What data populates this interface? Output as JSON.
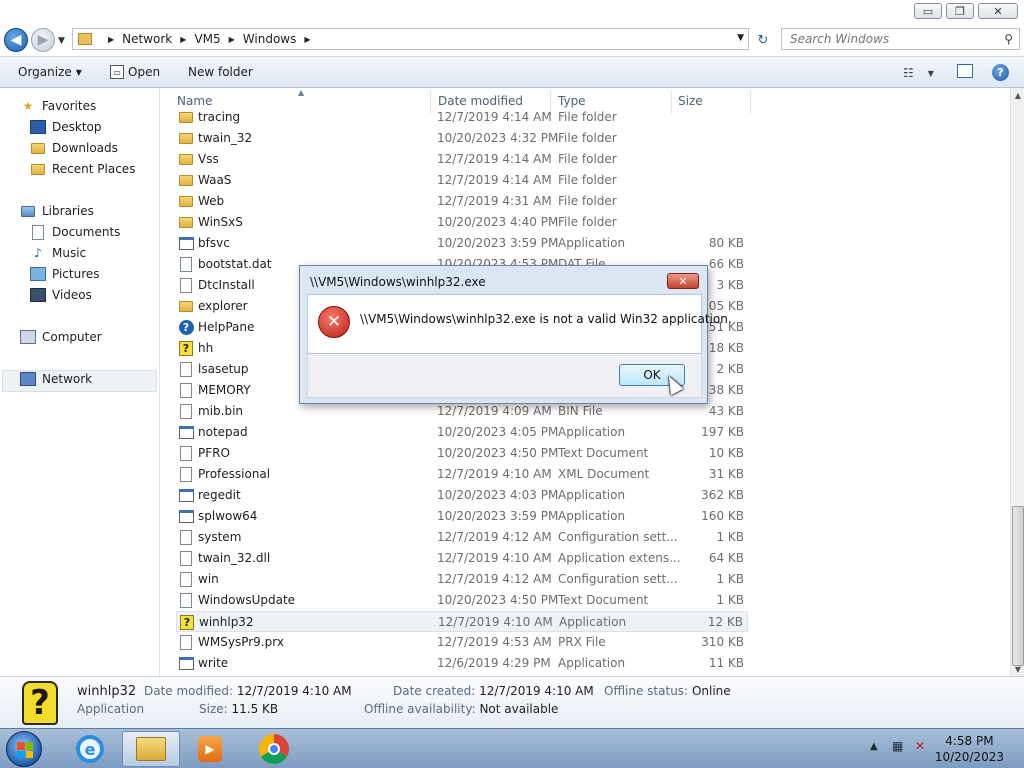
{
  "window": {
    "buttons": {
      "minimize": "▭",
      "maximize": "❐",
      "close": "✕"
    }
  },
  "address": {
    "crumbs": [
      "Network",
      "VM5",
      "Windows"
    ],
    "search_placeholder": "Search Windows"
  },
  "toolbar": {
    "organize": "Organize",
    "open": "Open",
    "new_folder": "New folder"
  },
  "navpane": {
    "favorites": "Favorites",
    "desktop": "Desktop",
    "downloads": "Downloads",
    "recent_places": "Recent Places",
    "libraries": "Libraries",
    "documents": "Documents",
    "music": "Music",
    "pictures": "Pictures",
    "videos": "Videos",
    "computer": "Computer",
    "network": "Network"
  },
  "columns": {
    "name": "Name",
    "date": "Date modified",
    "type": "Type",
    "size": "Size"
  },
  "files": [
    {
      "name": "tracing",
      "date": "12/7/2019 4:14 AM",
      "type": "File folder",
      "size": "",
      "icon": "folder"
    },
    {
      "name": "twain_32",
      "date": "10/20/2023 4:32 PM",
      "type": "File folder",
      "size": "",
      "icon": "folder"
    },
    {
      "name": "Vss",
      "date": "12/7/2019 4:14 AM",
      "type": "File folder",
      "size": "",
      "icon": "folder"
    },
    {
      "name": "WaaS",
      "date": "12/7/2019 4:14 AM",
      "type": "File folder",
      "size": "",
      "icon": "folder"
    },
    {
      "name": "Web",
      "date": "12/7/2019 4:31 AM",
      "type": "File folder",
      "size": "",
      "icon": "folder"
    },
    {
      "name": "WinSxS",
      "date": "10/20/2023 4:40 PM",
      "type": "File folder",
      "size": "",
      "icon": "folder"
    },
    {
      "name": "bfsvc",
      "date": "10/20/2023 3:59 PM",
      "type": "Application",
      "size": "80 KB",
      "icon": "app"
    },
    {
      "name": "bootstat.dat",
      "date": "10/20/2023 4:53 PM",
      "type": "DAT File",
      "size": "66 KB",
      "icon": "doc"
    },
    {
      "name": "DtcInstall",
      "date": "",
      "type": "",
      "size": "3 KB",
      "icon": "doc"
    },
    {
      "name": "explorer",
      "date": "",
      "type": "",
      "size": "205 KB",
      "icon": "folder"
    },
    {
      "name": "HelpPane",
      "date": "",
      "type": "",
      "size": "051 KB",
      "icon": "qblue"
    },
    {
      "name": "hh",
      "date": "",
      "type": "",
      "size": "18 KB",
      "icon": "help"
    },
    {
      "name": "lsasetup",
      "date": "",
      "type": "",
      "size": "2 KB",
      "icon": "doc"
    },
    {
      "name": "MEMORY",
      "date": "",
      "type": "",
      "size": "138 KB",
      "icon": "doc"
    },
    {
      "name": "mib.bin",
      "date": "12/7/2019 4:09 AM",
      "type": "BIN File",
      "size": "43 KB",
      "icon": "doc"
    },
    {
      "name": "notepad",
      "date": "10/20/2023 4:05 PM",
      "type": "Application",
      "size": "197 KB",
      "icon": "app"
    },
    {
      "name": "PFRO",
      "date": "10/20/2023 4:50 PM",
      "type": "Text Document",
      "size": "10 KB",
      "icon": "doc"
    },
    {
      "name": "Professional",
      "date": "12/7/2019 4:10 AM",
      "type": "XML Document",
      "size": "31 KB",
      "icon": "doc"
    },
    {
      "name": "regedit",
      "date": "10/20/2023 4:03 PM",
      "type": "Application",
      "size": "362 KB",
      "icon": "app"
    },
    {
      "name": "splwow64",
      "date": "10/20/2023 3:59 PM",
      "type": "Application",
      "size": "160 KB",
      "icon": "app"
    },
    {
      "name": "system",
      "date": "12/7/2019 4:12 AM",
      "type": "Configuration sett...",
      "size": "1 KB",
      "icon": "doc"
    },
    {
      "name": "twain_32.dll",
      "date": "12/7/2019 4:10 AM",
      "type": "Application extens...",
      "size": "64 KB",
      "icon": "doc"
    },
    {
      "name": "win",
      "date": "12/7/2019 4:12 AM",
      "type": "Configuration sett...",
      "size": "1 KB",
      "icon": "doc"
    },
    {
      "name": "WindowsUpdate",
      "date": "10/20/2023 4:50 PM",
      "type": "Text Document",
      "size": "1 KB",
      "icon": "doc"
    },
    {
      "name": "winhlp32",
      "date": "12/7/2019 4:10 AM",
      "type": "Application",
      "size": "12 KB",
      "icon": "help",
      "selected": true
    },
    {
      "name": "WMSysPr9.prx",
      "date": "12/7/2019 4:53 AM",
      "type": "PRX File",
      "size": "310 KB",
      "icon": "doc"
    },
    {
      "name": "write",
      "date": "12/6/2019 4:29 PM",
      "type": "Application",
      "size": "11 KB",
      "icon": "app"
    }
  ],
  "details": {
    "name": "winhlp32",
    "kind": "Application",
    "date_modified_label": "Date modified:",
    "date_modified": "12/7/2019 4:10 AM",
    "size_label": "Size:",
    "size": "11.5 KB",
    "date_created_label": "Date created:",
    "date_created": "12/7/2019 4:10 AM",
    "offline_availability_label": "Offline availability:",
    "offline_availability": "Not available",
    "offline_status_label": "Offline status:",
    "offline_status": "Online"
  },
  "dialog": {
    "title": "\\\\VM5\\Windows\\winhlp32.exe",
    "message": "\\\\VM5\\Windows\\winhlp32.exe is not a valid Win32 application.",
    "ok": "OK",
    "close": "✕"
  },
  "taskbar": {
    "time": "4:58 PM",
    "date": "10/20/2023"
  }
}
